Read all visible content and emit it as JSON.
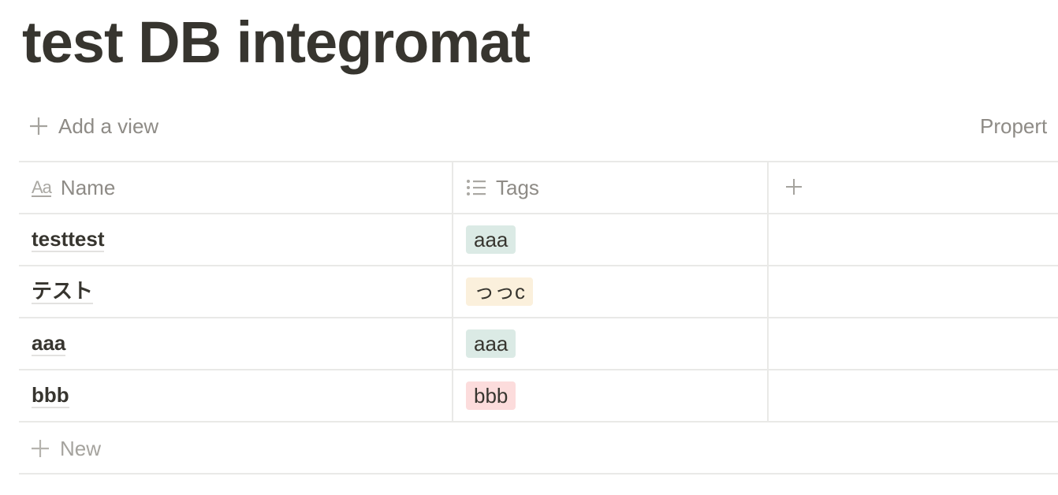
{
  "page": {
    "title": "test DB integromat"
  },
  "view_bar": {
    "add_view_label": "Add a view",
    "add_view_icon": "plus-icon",
    "properties_label": "Propert"
  },
  "table": {
    "columns": [
      {
        "label": "Name",
        "icon": "text-aa-icon"
      },
      {
        "label": "Tags",
        "icon": "list-icon"
      },
      {
        "label": "",
        "icon": "plus-icon"
      }
    ],
    "rows": [
      {
        "name": "testtest",
        "tag": "aaa",
        "tag_color": "#dbeae5"
      },
      {
        "name": "テスト",
        "tag": "っっc",
        "tag_color": "#fbf0dc"
      },
      {
        "name": "aaa",
        "tag": "aaa",
        "tag_color": "#dbeae5"
      },
      {
        "name": "bbb",
        "tag": "bbb",
        "tag_color": "#fcdcdc"
      }
    ]
  },
  "footer": {
    "new_label": "New",
    "new_icon": "plus-icon"
  },
  "colors": {
    "text": "#37352f",
    "muted": "#8e8b86",
    "border": "#e9e9e7"
  }
}
